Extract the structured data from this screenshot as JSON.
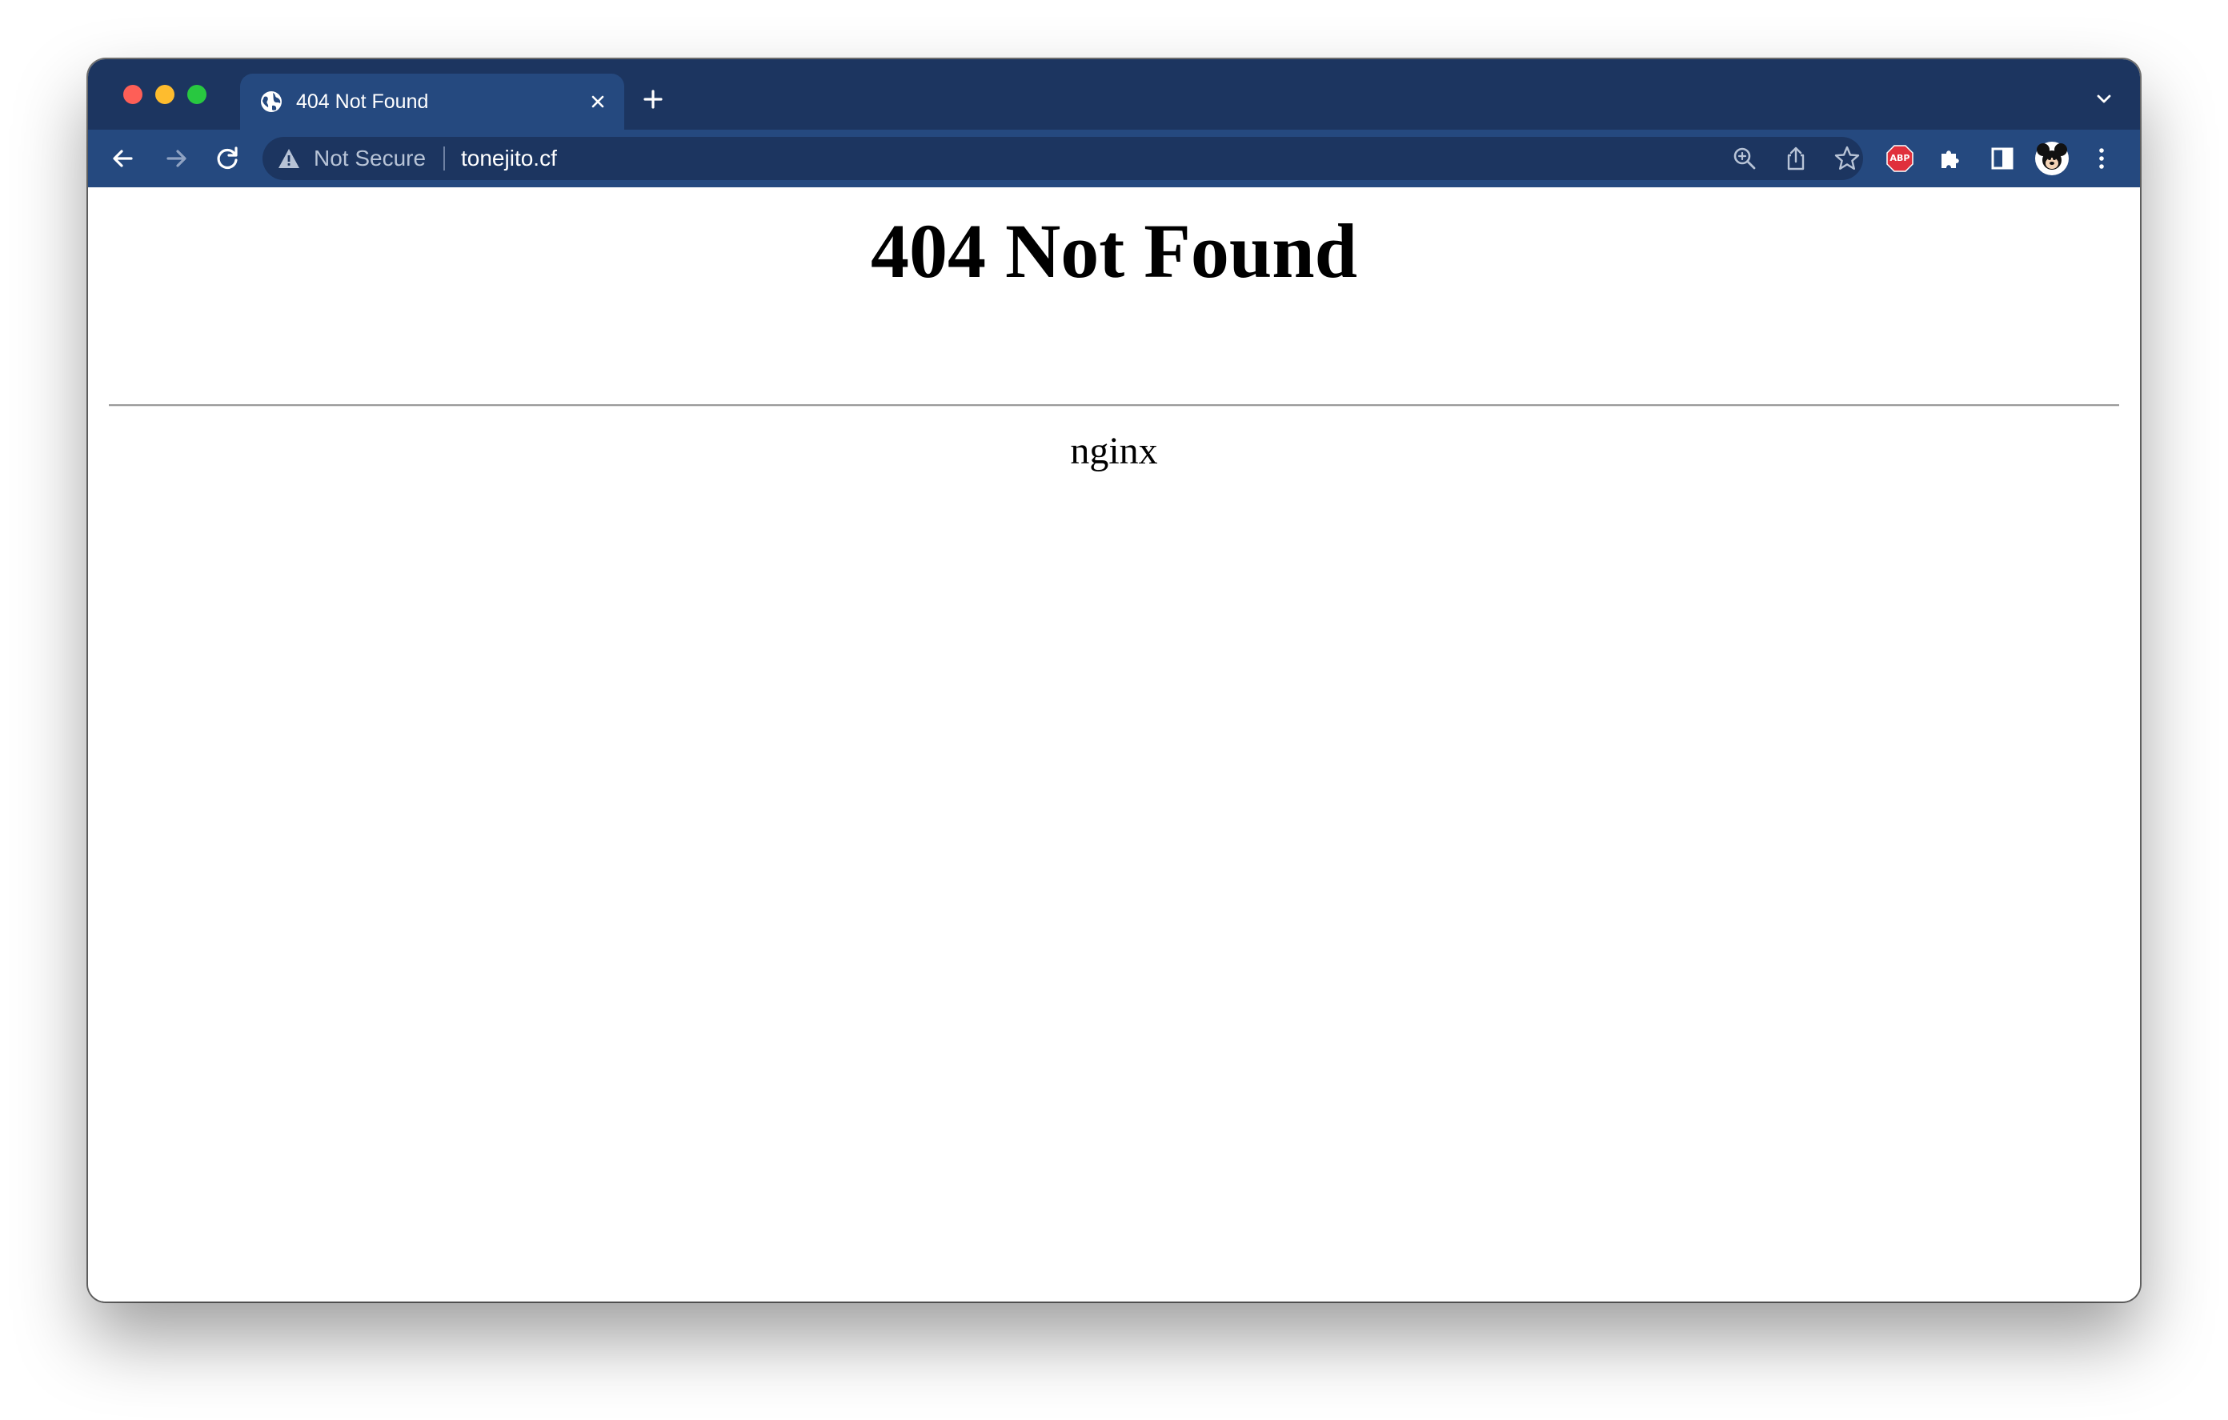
{
  "colors": {
    "titlebar": "#1c3560",
    "toolbar": "#25497f",
    "tab_active": "#25497f",
    "traffic_close": "#fe5f57",
    "traffic_minimize": "#febc2e",
    "traffic_maximize": "#28c840",
    "abp_badge": "#e0303c"
  },
  "tab": {
    "title": "404 Not Found",
    "favicon": "globe-icon"
  },
  "toolbar": {
    "back_icon": "back-arrow-icon",
    "forward_icon": "forward-arrow-icon",
    "reload_icon": "reload-icon"
  },
  "address_bar": {
    "security_label": "Not Secure",
    "url": "tonejito.cf"
  },
  "extensions": {
    "adblock_badge": "ABP"
  },
  "page": {
    "heading": "404 Not Found",
    "server": "nginx"
  }
}
